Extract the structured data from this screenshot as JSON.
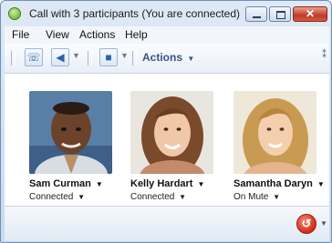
{
  "window": {
    "title": "Call with 3 participants (You are connected)"
  },
  "menu": [
    "File",
    "View",
    "Actions",
    "Help"
  ],
  "toolbar": {
    "actions_label": "Actions",
    "icons": [
      "phone-icon",
      "speaker-icon",
      "video-icon"
    ]
  },
  "participants": [
    {
      "name": "Sam Curman",
      "status": "Connected"
    },
    {
      "name": "Kelly Hardart",
      "status": "Connected"
    },
    {
      "name": "Samantha Daryn",
      "status": "On Mute"
    }
  ],
  "colors": {
    "title_bar": "#c9d9ee",
    "accent_blue": "#35557f",
    "hangup_red": "#d22c14",
    "app_icon_green": "#59a82c"
  }
}
